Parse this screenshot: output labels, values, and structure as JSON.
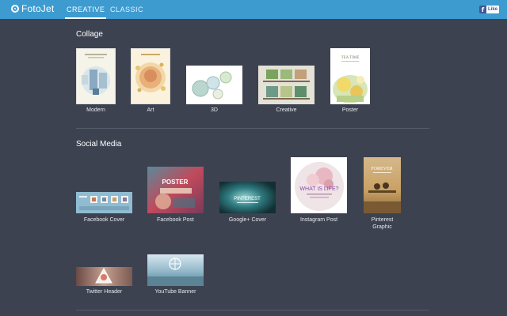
{
  "app": {
    "logo_text": "FotoJet"
  },
  "nav": {
    "tabs": [
      {
        "label": "CREATIVE",
        "active": true
      },
      {
        "label": "CLASSIC",
        "active": false
      }
    ]
  },
  "fb": {
    "icon": "f",
    "label": "Like"
  },
  "sections": {
    "collage": {
      "title": "Collage",
      "items": [
        {
          "label": "Modern"
        },
        {
          "label": "Art"
        },
        {
          "label": "3D"
        },
        {
          "label": "Creative"
        },
        {
          "label": "Poster"
        }
      ]
    },
    "social": {
      "title": "Social Media",
      "items": [
        {
          "label": "Facebook Cover"
        },
        {
          "label": "Facebook Post"
        },
        {
          "label": "Google+ Cover"
        },
        {
          "label": "Instagram Post"
        },
        {
          "label": "Pinterest\nGraphic"
        },
        {
          "label": "Twitter Header"
        },
        {
          "label": "YouTube Banner"
        }
      ]
    }
  },
  "thumb_text": {
    "poster": "TEA TIME",
    "fb_post": "POSTER",
    "gplus": "PINTEREST",
    "instagram": "WHAT IS LIFE?",
    "pinterest": "FOREVER"
  },
  "colors": {
    "topbar": "#3d9bd0",
    "background": "#3d4250",
    "divider": "#555b69"
  }
}
